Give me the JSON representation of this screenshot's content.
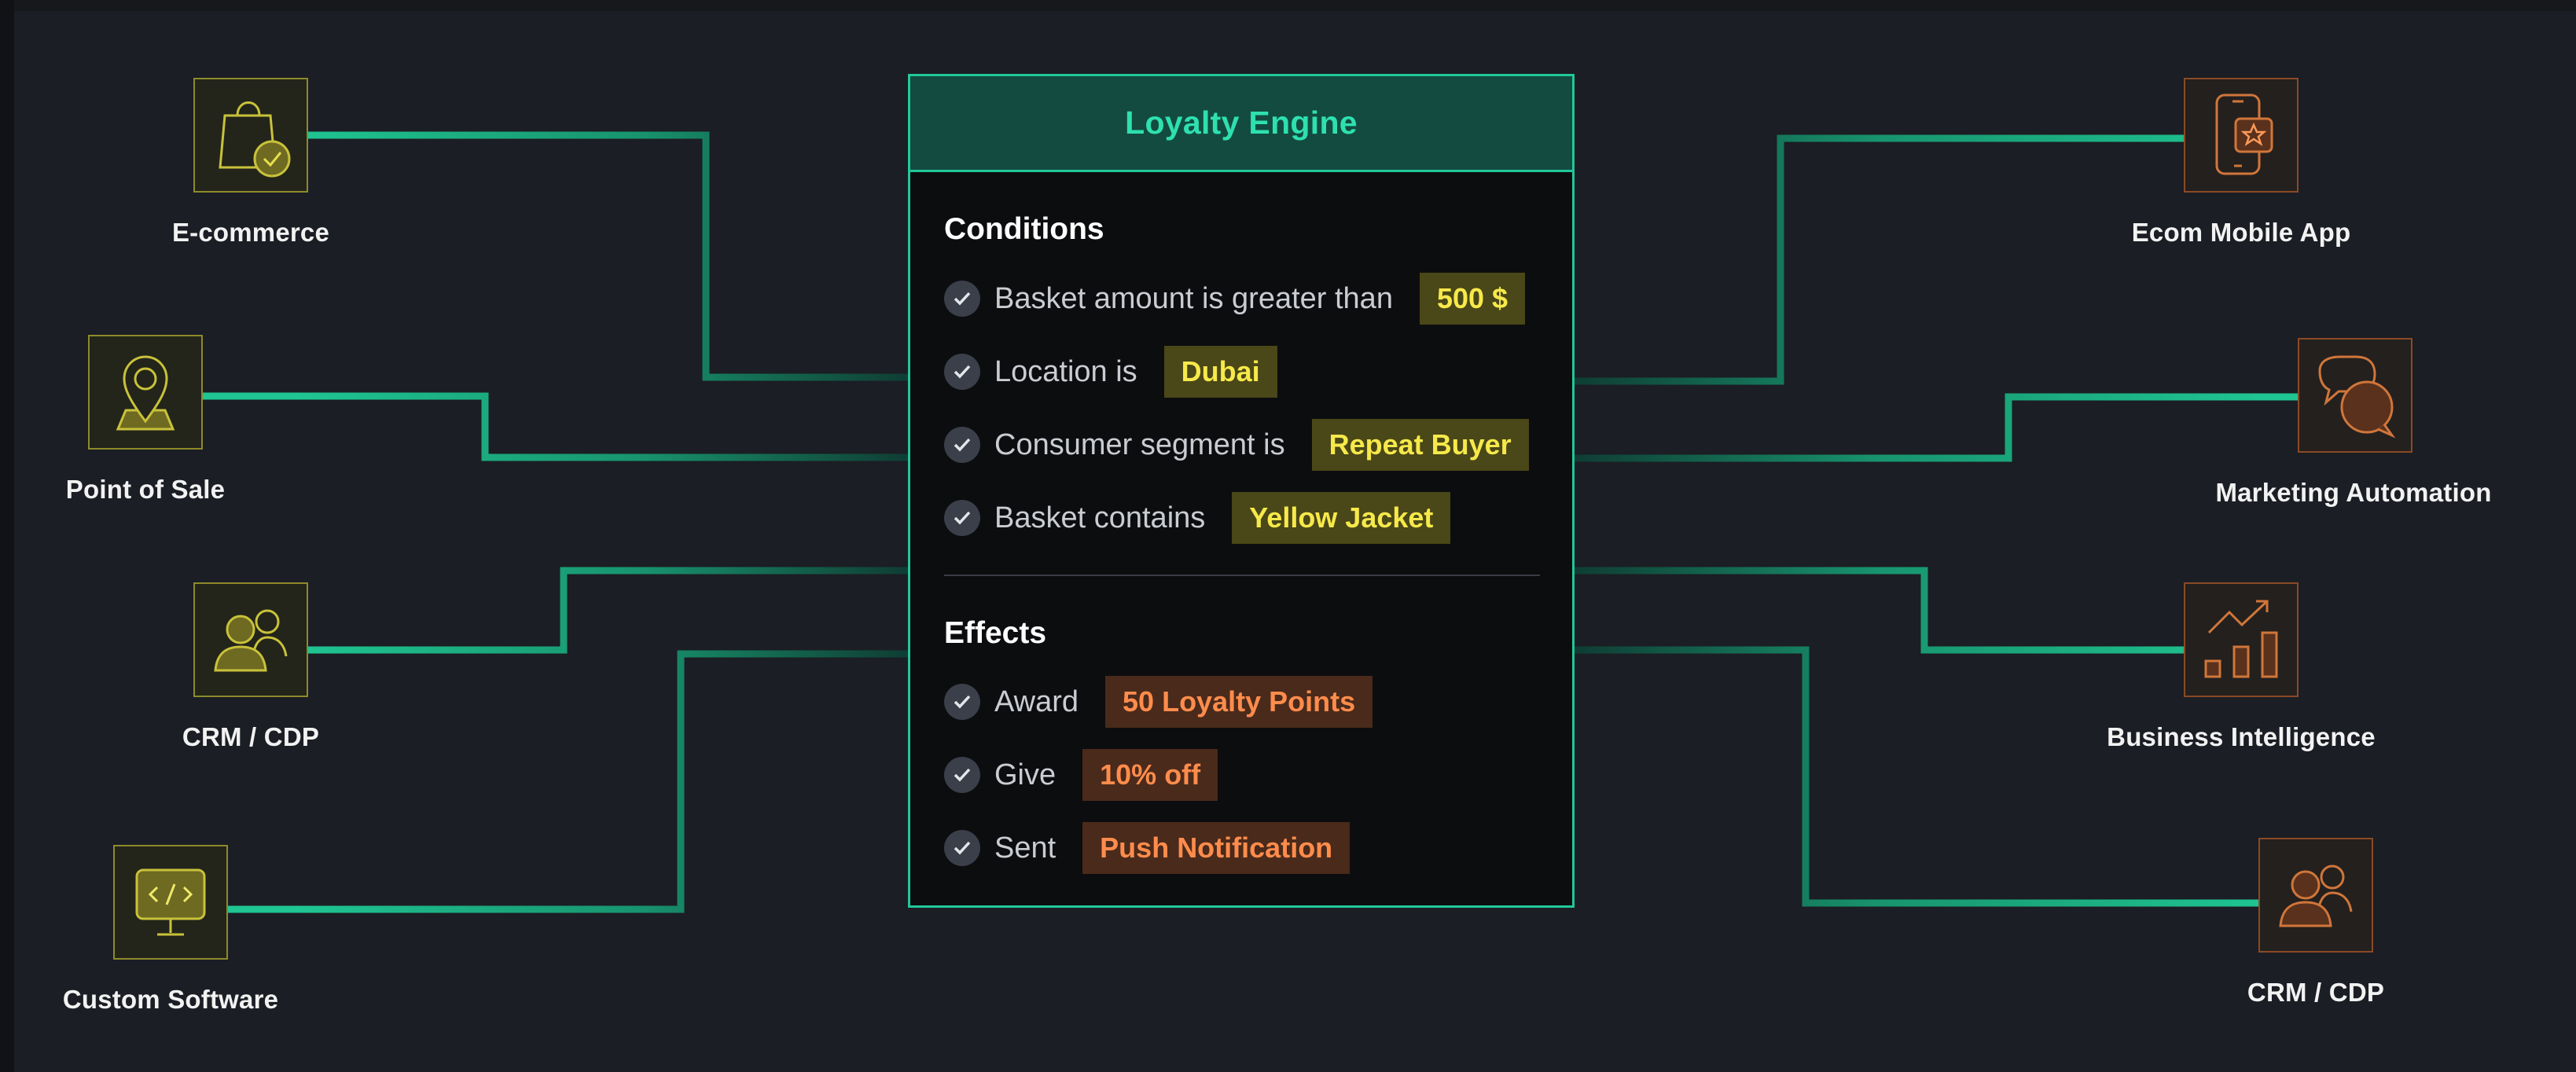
{
  "engine": {
    "title": "Loyalty Engine",
    "conditions_title": "Conditions",
    "conditions": [
      {
        "text": "Basket amount is greater than",
        "value": "500 $"
      },
      {
        "text": "Location is",
        "value": "Dubai"
      },
      {
        "text": "Consumer segment is",
        "value": "Repeat Buyer"
      },
      {
        "text": "Basket contains",
        "value": "Yellow Jacket"
      }
    ],
    "effects_title": "Effects",
    "effects": [
      {
        "text": "Award",
        "value": "50 Loyalty Points"
      },
      {
        "text": "Give",
        "value": "10% off"
      },
      {
        "text": "Sent",
        "value": "Push Notification"
      }
    ]
  },
  "sources": [
    {
      "label": "E-commerce",
      "icon": "shopping-bag-check-icon"
    },
    {
      "label": "Point of Sale",
      "icon": "map-pin-icon"
    },
    {
      "label": "CRM / CDP",
      "icon": "users-icon"
    },
    {
      "label": "Custom Software",
      "icon": "code-monitor-icon"
    }
  ],
  "destinations": [
    {
      "label": "Ecom Mobile App",
      "icon": "mobile-star-icon"
    },
    {
      "label": "Marketing Automation",
      "icon": "chat-bubbles-icon"
    },
    {
      "label": "Business Intelligence",
      "icon": "bar-chart-trend-icon"
    },
    {
      "label": "CRM / CDP",
      "icon": "users-icon"
    }
  ],
  "colors": {
    "background": "#1b1e24",
    "wire": "#1fc592",
    "engine_border": "#22c79a",
    "engine_header": "#134b40",
    "condition_chip": "#4a4718",
    "condition_text": "#f6e94a",
    "effect_chip": "#4a2a1b",
    "effect_text": "#ff8c4c"
  }
}
